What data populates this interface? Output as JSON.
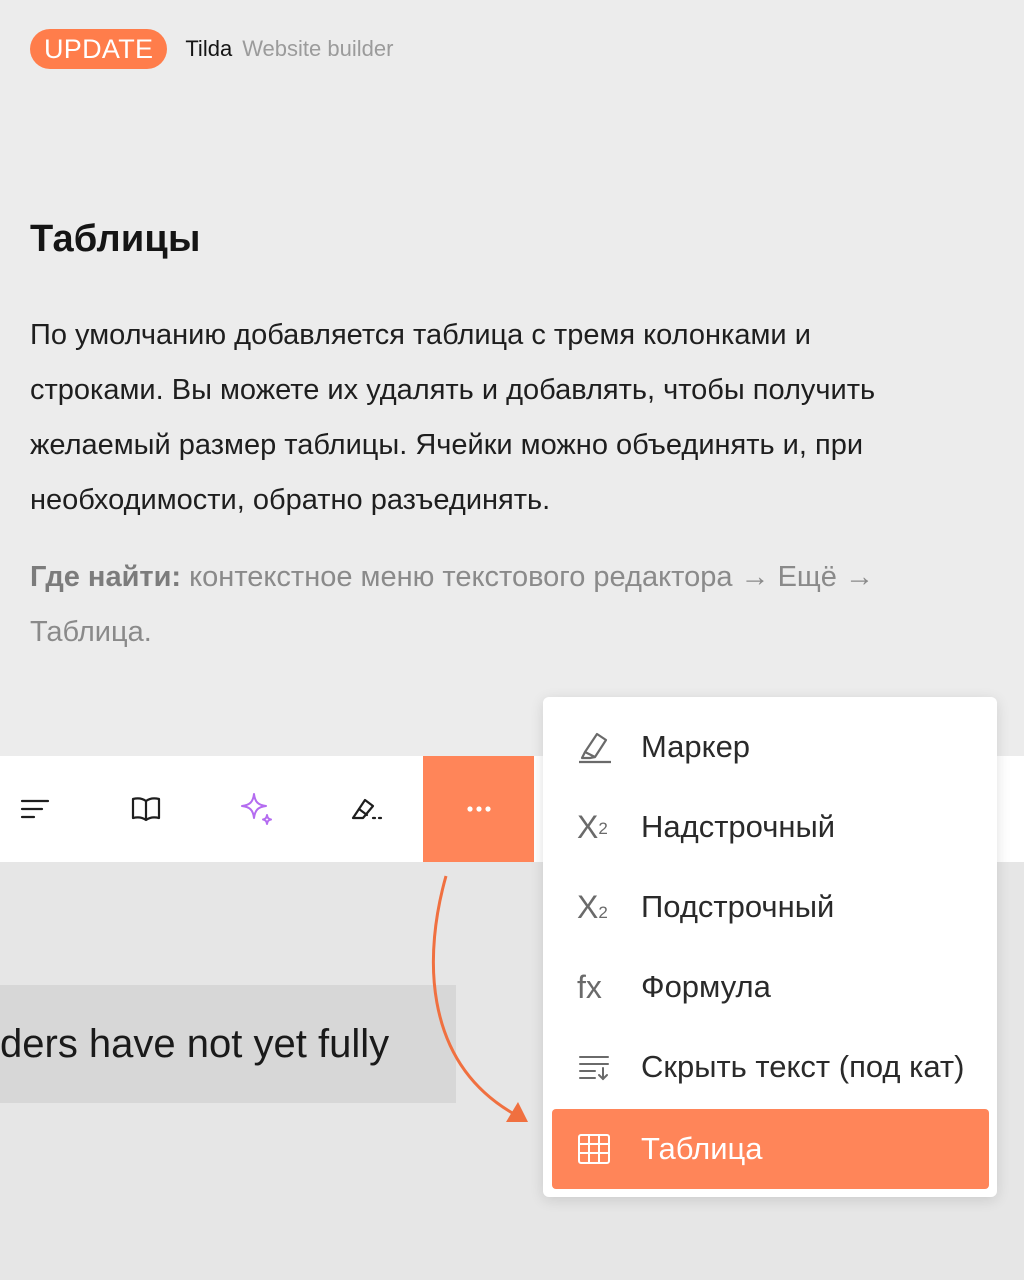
{
  "header": {
    "badge": "UPDATE",
    "brand": "Tilda",
    "brand_sub": "Website builder"
  },
  "article": {
    "title": "Таблицы",
    "body": "По умолчанию добавляется таблица с тремя колонками и строками. Вы можете их удалять и добавлять, чтобы получить желаемый размер таблицы. Ячейки можно объединять и, при необходимости, обратно разъединять.",
    "where_label": "Где найти:",
    "where_text": "контекстное меню текстового редактора → Ещё → Таблица."
  },
  "editor": {
    "content_text": "ders have not yet fully"
  },
  "toolbar": {
    "tools": [
      {
        "icon": "align-left-icon"
      },
      {
        "icon": "book-icon"
      },
      {
        "icon": "ai-sparkle-icon",
        "color": "#b46cf0"
      },
      {
        "icon": "eraser-icon"
      },
      {
        "icon": "more-dots-icon",
        "active": true
      }
    ],
    "accent": "#ff8559"
  },
  "menu": {
    "items": [
      {
        "icon": "marker-icon",
        "label": "Маркер"
      },
      {
        "icon": "superscript-icon",
        "glyph": "X",
        "mark": "2",
        "label": "Надстрочный"
      },
      {
        "icon": "subscript-icon",
        "glyph": "X",
        "mark": "2",
        "label": "Подстрочный"
      },
      {
        "icon": "formula-icon",
        "glyph": "fx",
        "label": "Формула"
      },
      {
        "icon": "hide-text-icon",
        "label": "Скрыть текст (под кат)"
      },
      {
        "icon": "table-icon",
        "label": "Таблица",
        "selected": true
      }
    ]
  }
}
